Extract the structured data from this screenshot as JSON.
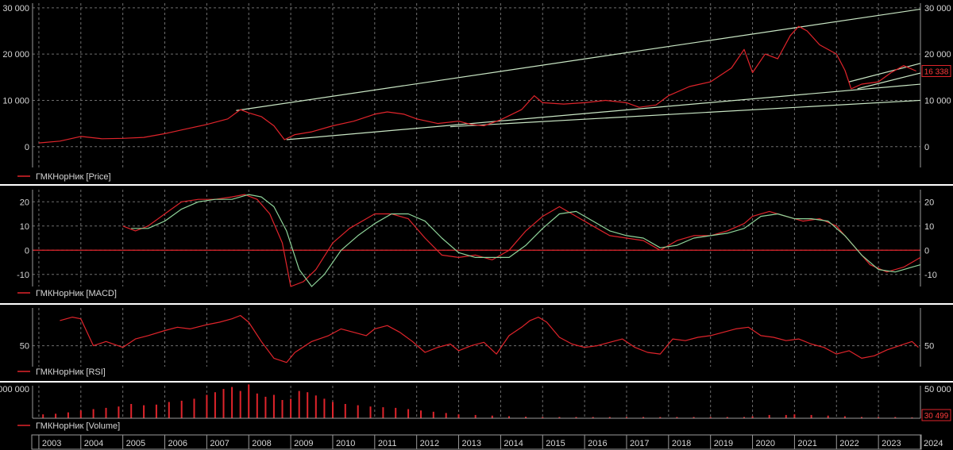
{
  "colors": {
    "background": "#000000",
    "grid": "#6e6e6e",
    "axis": "#9a9a9a",
    "text": "#d6d6d6",
    "series_red": "#e0242b",
    "series_green": "#8fd49a",
    "trend": "#c9e6c4",
    "separator": "#ffffff",
    "tag_text": "#ff3b3b"
  },
  "chart_data": [
    {
      "type": "line",
      "id": "price",
      "legend": "ГМКНорНик [Price]",
      "ylim": [
        -4500,
        31000
      ],
      "yticks": [
        0,
        10000,
        20000,
        30000
      ],
      "ytick_labels": [
        "0",
        "10 000",
        "20 000",
        "30 000"
      ],
      "last_value_label": "16 338",
      "last_value": 16338,
      "series": [
        {
          "color_key": "series_red",
          "x": [
            2003.0,
            2003.5,
            2004.0,
            2004.5,
            2005.0,
            2005.5,
            2006.0,
            2006.5,
            2007.0,
            2007.5,
            2007.8,
            2008.0,
            2008.3,
            2008.6,
            2008.85,
            2009.1,
            2009.5,
            2010.0,
            2010.5,
            2011.0,
            2011.3,
            2011.7,
            2012.0,
            2012.5,
            2013.0,
            2013.3,
            2013.6,
            2014.0,
            2014.5,
            2014.8,
            2015.0,
            2015.5,
            2016.0,
            2016.5,
            2017.0,
            2017.3,
            2017.7,
            2018.0,
            2018.5,
            2019.0,
            2019.5,
            2019.8,
            2020.0,
            2020.3,
            2020.6,
            2020.9,
            2021.1,
            2021.3,
            2021.6,
            2022.0,
            2022.2,
            2022.35,
            2022.6,
            2023.0,
            2023.3,
            2023.6,
            2023.9
          ],
          "y": [
            800,
            1200,
            2200,
            1700,
            1800,
            2000,
            2800,
            3800,
            4800,
            6000,
            8000,
            7300,
            6500,
            4500,
            1500,
            2600,
            3200,
            4500,
            5500,
            7000,
            7500,
            7000,
            6000,
            5000,
            5500,
            4800,
            4500,
            5800,
            8000,
            11000,
            9500,
            9200,
            9500,
            10000,
            9500,
            8500,
            9000,
            11000,
            13000,
            14000,
            17000,
            21000,
            16000,
            20000,
            19000,
            24000,
            26000,
            25000,
            22000,
            20000,
            16500,
            12500,
            13500,
            14000,
            16000,
            17500,
            16338
          ]
        }
      ],
      "trendlines": [
        {
          "x": [
            2007.7,
            2024.0
          ],
          "y": [
            7800,
            29700
          ]
        },
        {
          "x": [
            2008.9,
            2024.0
          ],
          "y": [
            1500,
            13500
          ]
        },
        {
          "x": [
            2012.8,
            2024.0
          ],
          "y": [
            4300,
            10000
          ]
        },
        {
          "x": [
            2022.3,
            2024.0
          ],
          "y": [
            14000,
            18000
          ]
        },
        {
          "x": [
            2022.5,
            2024.0
          ],
          "y": [
            12500,
            15900
          ]
        }
      ]
    },
    {
      "type": "line",
      "id": "macd",
      "legend": "ГМКНорНик [MACD]",
      "ylim": [
        -15,
        25
      ],
      "yticks": [
        -10,
        0,
        10,
        20
      ],
      "ytick_labels": [
        "-10",
        "0",
        "10",
        "20"
      ],
      "zero_line": 0,
      "series": [
        {
          "color_key": "series_red",
          "x": [
            2005.0,
            2005.3,
            2005.6,
            2006.0,
            2006.4,
            2006.8,
            2007.2,
            2007.6,
            2007.9,
            2008.2,
            2008.5,
            2008.8,
            2009.0,
            2009.3,
            2009.6,
            2010.0,
            2010.4,
            2010.8,
            2011.0,
            2011.4,
            2011.8,
            2012.2,
            2012.6,
            2013.0,
            2013.4,
            2013.8,
            2014.2,
            2014.6,
            2015.0,
            2015.4,
            2015.8,
            2016.2,
            2016.6,
            2017.0,
            2017.4,
            2017.8,
            2018.2,
            2018.6,
            2019.0,
            2019.4,
            2019.8,
            2020.0,
            2020.4,
            2020.8,
            2021.2,
            2021.6,
            2022.0,
            2022.4,
            2022.8,
            2023.2,
            2023.6,
            2024.0
          ],
          "y": [
            10,
            8,
            10,
            15,
            20,
            21,
            21,
            22,
            23,
            21,
            15,
            3,
            -15,
            -13,
            -8,
            3,
            9,
            13,
            15,
            15,
            13,
            5,
            -2,
            -3,
            -2,
            -4,
            0,
            8,
            14,
            18,
            14,
            10,
            6,
            5,
            4,
            0,
            4,
            6,
            6,
            8,
            11,
            14,
            16,
            14,
            12,
            13,
            10,
            2,
            -6,
            -9,
            -7,
            -3
          ]
        },
        {
          "color_key": "series_green",
          "x": [
            2005.2,
            2005.6,
            2006.0,
            2006.4,
            2006.8,
            2007.2,
            2007.6,
            2008.0,
            2008.3,
            2008.6,
            2008.9,
            2009.2,
            2009.5,
            2009.8,
            2010.2,
            2010.6,
            2011.0,
            2011.4,
            2011.8,
            2012.2,
            2012.6,
            2013.0,
            2013.4,
            2013.8,
            2014.2,
            2014.6,
            2015.0,
            2015.4,
            2015.8,
            2016.2,
            2016.6,
            2017.0,
            2017.4,
            2017.8,
            2018.2,
            2018.6,
            2019.0,
            2019.4,
            2019.8,
            2020.2,
            2020.6,
            2021.0,
            2021.4,
            2021.8,
            2022.2,
            2022.6,
            2023.0,
            2023.4,
            2023.8,
            2024.0
          ],
          "y": [
            9,
            9,
            12,
            17,
            20,
            21,
            21,
            23,
            22,
            18,
            8,
            -8,
            -15,
            -10,
            0,
            6,
            11,
            15,
            15,
            12,
            5,
            -1,
            -3,
            -3,
            -3,
            2,
            9,
            15,
            16,
            12,
            8,
            6,
            5,
            1,
            2,
            5,
            6,
            7,
            9,
            14,
            15,
            13,
            13,
            12,
            6,
            -2,
            -8,
            -9,
            -7,
            -6
          ]
        }
      ]
    },
    {
      "type": "line",
      "id": "rsi",
      "legend": "ГМКНорНик [RSI]",
      "ylim": [
        25,
        95
      ],
      "yticks": [
        50
      ],
      "ytick_labels": [
        "50"
      ],
      "series": [
        {
          "color_key": "series_red",
          "x": [
            2003.5,
            2003.8,
            2004.0,
            2004.3,
            2004.6,
            2005.0,
            2005.3,
            2005.6,
            2006.0,
            2006.3,
            2006.6,
            2007.0,
            2007.3,
            2007.6,
            2007.8,
            2008.0,
            2008.3,
            2008.6,
            2008.9,
            2009.1,
            2009.5,
            2009.9,
            2010.2,
            2010.5,
            2010.8,
            2011.0,
            2011.3,
            2011.6,
            2011.9,
            2012.2,
            2012.5,
            2012.8,
            2013.0,
            2013.3,
            2013.6,
            2013.9,
            2014.2,
            2014.5,
            2014.7,
            2014.9,
            2015.1,
            2015.4,
            2015.7,
            2016.0,
            2016.3,
            2016.6,
            2016.9,
            2017.2,
            2017.5,
            2017.8,
            2018.1,
            2018.4,
            2018.7,
            2019.0,
            2019.3,
            2019.6,
            2019.9,
            2020.2,
            2020.5,
            2020.8,
            2021.1,
            2021.4,
            2021.7,
            2022.0,
            2022.3,
            2022.6,
            2022.9,
            2023.2,
            2023.5,
            2023.8,
            2023.95
          ],
          "y": [
            80,
            84,
            82,
            50,
            55,
            48,
            58,
            62,
            68,
            72,
            70,
            75,
            78,
            82,
            86,
            78,
            55,
            35,
            30,
            42,
            55,
            62,
            70,
            66,
            62,
            70,
            74,
            66,
            55,
            42,
            48,
            52,
            44,
            50,
            54,
            40,
            62,
            72,
            80,
            84,
            78,
            60,
            52,
            48,
            50,
            54,
            58,
            48,
            42,
            40,
            58,
            56,
            60,
            62,
            66,
            70,
            72,
            62,
            60,
            56,
            58,
            52,
            48,
            40,
            44,
            35,
            38,
            45,
            50,
            55,
            48
          ]
        }
      ]
    },
    {
      "type": "bar",
      "id": "volume",
      "legend": "ГМКНорНик [Volume]",
      "ylim": [
        0,
        50000
      ],
      "left_tick_label": "000 000",
      "right_tick_label": "50 000",
      "last_value_label": "30 499",
      "last_value": 30499,
      "bars": {
        "color_key": "series_red",
        "x": [
          2003.1,
          2003.4,
          2003.7,
          2004.0,
          2004.3,
          2004.6,
          2004.9,
          2005.2,
          2005.5,
          2005.8,
          2006.1,
          2006.4,
          2006.7,
          2007.0,
          2007.2,
          2007.4,
          2007.6,
          2007.8,
          2008.0,
          2008.2,
          2008.4,
          2008.6,
          2008.8,
          2009.0,
          2009.2,
          2009.4,
          2009.6,
          2009.8,
          2010.0,
          2010.3,
          2010.6,
          2010.9,
          2011.2,
          2011.5,
          2011.8,
          2012.1,
          2012.4,
          2012.7,
          2013.0,
          2013.4,
          2013.8,
          2014.2,
          2014.6,
          2015.0,
          2015.4,
          2015.8,
          2016.2,
          2016.6,
          2017.0,
          2017.4,
          2017.8,
          2018.2,
          2018.6,
          2019.0,
          2019.4,
          2019.8,
          2020.0,
          2020.4,
          2020.8,
          2021.0,
          2021.4,
          2021.8,
          2022.2,
          2022.6,
          2023.0,
          2023.4,
          2023.8
        ],
        "y": [
          6000,
          7000,
          9000,
          12000,
          14000,
          16000,
          18000,
          22000,
          20000,
          21000,
          25000,
          27000,
          30000,
          36000,
          40000,
          45000,
          48000,
          42000,
          52000,
          38000,
          33000,
          36000,
          28000,
          30000,
          42000,
          40000,
          35000,
          30000,
          25000,
          22000,
          20000,
          18000,
          17000,
          16000,
          14000,
          12000,
          10000,
          8000,
          6000,
          5000,
          4000,
          3000,
          2500,
          2000,
          2000,
          2000,
          2000,
          2000,
          2000,
          2000,
          2000,
          2000,
          2000,
          2000,
          2000,
          2000,
          3000,
          5000,
          5000,
          6000,
          5000,
          4000,
          3000,
          2000,
          2000,
          2000,
          1500
        ]
      }
    }
  ],
  "x_axis": {
    "domain": [
      2002.85,
      2024.0
    ],
    "labels": [
      "2003",
      "2004",
      "2005",
      "2006",
      "2007",
      "2008",
      "2009",
      "2010",
      "2011",
      "2012",
      "2013",
      "2014",
      "2015",
      "2016",
      "2017",
      "2018",
      "2019",
      "2020",
      "2021",
      "2022",
      "2023",
      "2024"
    ]
  }
}
